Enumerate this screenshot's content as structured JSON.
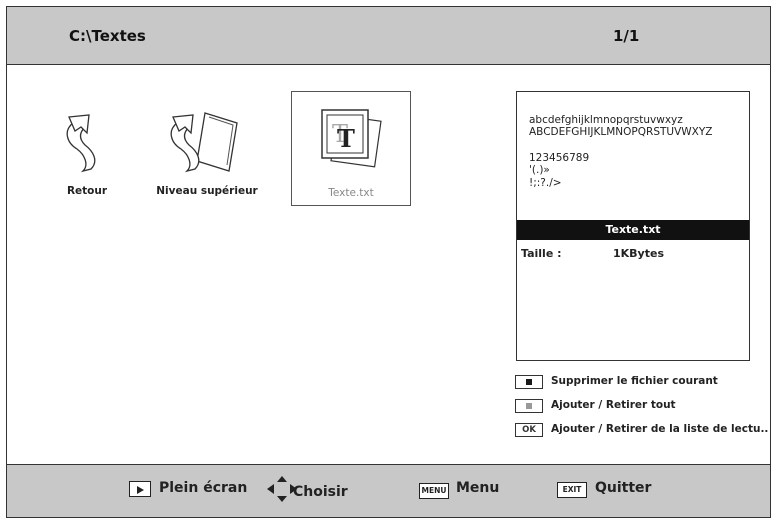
{
  "header": {
    "path": "C:\\Textes",
    "page_indicator": "1/1"
  },
  "items": [
    {
      "label": "Retour",
      "icon": "return-arrow-icon"
    },
    {
      "label": "Niveau supérieur",
      "icon": "parent-folder-icon"
    },
    {
      "label": "Texte.txt",
      "icon": "text-file-icon",
      "selected": true
    }
  ],
  "file_icon_glyph": "T",
  "preview": {
    "sample_lines": [
      "abcdefghijklmnopqrstuvwxyz",
      "ABCDEFGHIJKLMNOPQRSTUVWXYZ",
      "123456789",
      "'(.)»",
      "!;:?./>"
    ],
    "file_name": "Texte.txt",
    "size_label": "Taille :",
    "size_value": "1KBytes"
  },
  "actions": [
    {
      "key": "red-square",
      "label": "Supprimer le fichier courant",
      "color": "#1a1a1a"
    },
    {
      "key": "green-square",
      "label": "Ajouter / Retirer tout",
      "color": "#999999"
    },
    {
      "key": "OK",
      "label": "Ajouter / Retirer de la liste de lectu.."
    }
  ],
  "footer": {
    "play": "Plein écran",
    "navigate": "Choisir",
    "menu_key": "MENU",
    "menu": "Menu",
    "exit_key": "EXIT",
    "exit": "Quitter"
  }
}
